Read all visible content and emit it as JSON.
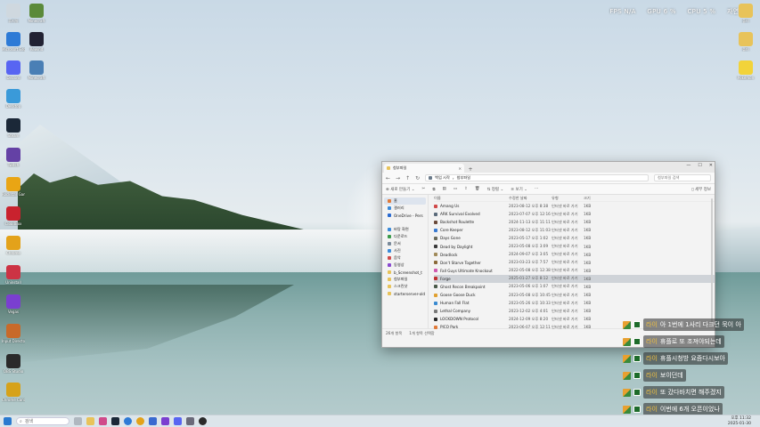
{
  "hud": {
    "fps_label": "FPS",
    "fps_value": "N/A",
    "gpu_label": "GPU",
    "gpu_value": "6 %",
    "cpu_label": "CPU",
    "cpu_value": "5 %",
    "extra": "자연사이"
  },
  "desktop_left": [
    {
      "label": "휴지통",
      "icon": "recycle-bin-icon",
      "color": "#cfd8df"
    },
    {
      "label": "Minecraft",
      "icon": "minecraft-icon",
      "color": "#5b8a3a"
    },
    {
      "label": "Microsoft Edge",
      "icon": "edge-icon",
      "color": "#2d7ad6"
    },
    {
      "label": "Rewind",
      "icon": "r-app-icon",
      "color": "#223"
    },
    {
      "label": "Discord",
      "icon": "discord-icon",
      "color": "#5865f2"
    },
    {
      "label": "Minecraft",
      "icon": "app-icon",
      "color": "#4a7fb5"
    },
    {
      "label": "Desktop",
      "icon": "monitor-icon",
      "color": "#3a9ad9"
    },
    {
      "label": "Steam",
      "icon": "steam-icon",
      "color": "#1b2838"
    },
    {
      "label": "Twitch",
      "icon": "twitch-icon",
      "color": "#6441a5"
    },
    {
      "label": "Rockstar Games",
      "icon": "rockstar-icon",
      "color": "#e9a514"
    },
    {
      "label": "CloudBox",
      "icon": "red-app-icon",
      "color": "#c9222e"
    },
    {
      "label": "Chrome",
      "icon": "chrome-icon",
      "color": "#e3a21a"
    },
    {
      "label": "Uninstall",
      "icon": "shield-icon",
      "color": "#cc3344"
    },
    {
      "label": "Vegas",
      "icon": "x-app-icon",
      "color": "#7a3fd0"
    },
    {
      "label": "Input Director",
      "icon": "id-icon",
      "color": "#c86a2a"
    },
    {
      "label": "OBS Studio",
      "icon": "obs-icon",
      "color": "#2a2a2a"
    },
    {
      "label": "Chrome Canary",
      "icon": "canary-icon",
      "color": "#d6a21a"
    }
  ],
  "desktop_right": [
    {
      "label": "폴더",
      "icon": "folder-icon",
      "color": "#e8c35a"
    },
    {
      "label": "폴더",
      "icon": "folder-icon",
      "color": "#e8c35a"
    },
    {
      "label": "Pokémon",
      "icon": "pikachu-icon",
      "color": "#f2d33a"
    }
  ],
  "explorer": {
    "tab_title": "첨부파일",
    "path_root": "백업 시작",
    "path_current": "첨부파일",
    "search_placeholder": "첨부파일 검색",
    "toolbar": {
      "new": "새로 만들기",
      "sort": "정렬",
      "view": "보기",
      "more": "···",
      "details": "세부 정보"
    },
    "sidebar": [
      {
        "label": "홈",
        "icon": "home-icon",
        "color": "#e07a3a",
        "selected": true
      },
      {
        "label": "갤러리",
        "icon": "gallery-icon",
        "color": "#3a8ad9"
      },
      {
        "label": "OneDrive - Pers",
        "icon": "onedrive-icon",
        "color": "#2a6ad0"
      },
      {
        "label": "바탕 화면",
        "icon": "desktop-icon",
        "color": "#3a8ad9"
      },
      {
        "label": "다운로드",
        "icon": "download-icon",
        "color": "#3a9a4a"
      },
      {
        "label": "문서",
        "icon": "document-icon",
        "color": "#7a8a9a"
      },
      {
        "label": "사진",
        "icon": "pictures-icon",
        "color": "#3a8ad9"
      },
      {
        "label": "음악",
        "icon": "music-icon",
        "color": "#d04a4a"
      },
      {
        "label": "동영상",
        "icon": "video-icon",
        "color": "#8a4ad0"
      },
      {
        "label": "b_Screenshot_t",
        "icon": "folder-icon",
        "color": "#e8c35a"
      },
      {
        "label": "첨부파일",
        "icon": "folder-icon",
        "color": "#e8c35a"
      },
      {
        "label": "스크린샷",
        "icon": "folder-icon",
        "color": "#e8c35a"
      },
      {
        "label": "starterserver-old",
        "icon": "folder-icon",
        "color": "#e8c35a"
      }
    ],
    "columns": [
      "이름",
      "수정한 날짜",
      "유형",
      "크기"
    ],
    "files": [
      {
        "name": "Amang Us",
        "date": "2023-08-12 오후 8:38",
        "type": "인터넷 바로 가기",
        "size": "1KB",
        "color": "#d04a4a"
      },
      {
        "name": "ARK Survival Evolved",
        "date": "2023-07-07 오후 12:16",
        "type": "인터넷 바로 가기",
        "size": "1KB",
        "color": "#5a6a7a"
      },
      {
        "name": "Backshot Roulette",
        "date": "2024-11-13 오후 11:11",
        "type": "인터넷 바로 가기",
        "size": "1KB",
        "color": "#6a4a3a"
      },
      {
        "name": "Core Keeper",
        "date": "2023-08-12 오후 11:03",
        "type": "인터넷 바로 가기",
        "size": "1KB",
        "color": "#3a7ad0"
      },
      {
        "name": "Days Gone",
        "date": "2023-05-17 오후 1:02",
        "type": "인터넷 바로 가기",
        "size": "1KB",
        "color": "#6a6a5a"
      },
      {
        "name": "Dead by Daylight",
        "date": "2023-05-08 오후 3:09",
        "type": "인터넷 바로 가기",
        "size": "1KB",
        "color": "#3a3a3a"
      },
      {
        "name": "Deadlock",
        "date": "2024-09-07 오후 3:05",
        "type": "인터넷 바로 가기",
        "size": "1KB",
        "color": "#a08a5a"
      },
      {
        "name": "Don't Starve Together",
        "date": "2023-03-23 오후 7:57",
        "type": "인터넷 바로 가기",
        "size": "1KB",
        "color": "#8a6a3a"
      },
      {
        "name": "Fall Guys Ultimate Knockout",
        "date": "2022-05-08 오후 12:38",
        "type": "인터넷 바로 가기",
        "size": "1KB",
        "color": "#d05ab0"
      },
      {
        "name": "Forge",
        "date": "2025-01-27 오후 8:12",
        "type": "인터넷 바로 가기",
        "size": "1KB",
        "color": "#c03030",
        "selected": true
      },
      {
        "name": "Ghost Recon Breakpoint",
        "date": "2023-05-06 오후 1:07",
        "type": "인터넷 바로 가기",
        "size": "1KB",
        "color": "#4a5a4a"
      },
      {
        "name": "Goose Goose Duck",
        "date": "2023-05-08 오후 10:45",
        "type": "인터넷 바로 가기",
        "size": "1KB",
        "color": "#e0a030"
      },
      {
        "name": "Human Fall Flat",
        "date": "2023-05-26 오후 10:33",
        "type": "인터넷 바로 가기",
        "size": "1KB",
        "color": "#3a8ad0"
      },
      {
        "name": "Lethal Company",
        "date": "2023-12-02 오후 4:01",
        "type": "인터넷 바로 가기",
        "size": "1KB",
        "color": "#7a7a7a"
      },
      {
        "name": "LOCKDOWN Protocol",
        "date": "2024-12-09 오후 8:20",
        "type": "인터넷 바로 가기",
        "size": "1KB",
        "color": "#2a2a2a"
      },
      {
        "name": "PICO Park",
        "date": "2023-06-07 오후 12:11",
        "type": "인터넷 바로 가기",
        "size": "1KB",
        "color": "#e07a3a"
      }
    ],
    "status": {
      "count": "26개 항목",
      "selected": "1개 항목 선택함"
    }
  },
  "chat": [
    {
      "name": "라이",
      "text": "아 1번에 1사리 다크던 묵이 아"
    },
    {
      "name": "라이",
      "text": "휴플로 또 조져야되는데"
    },
    {
      "name": "라이",
      "text": "휴플시청방 요즘다시보아"
    },
    {
      "name": "라이",
      "text": "보이던데"
    },
    {
      "name": "라이",
      "text": "또 갔다바치면 해주겠지"
    },
    {
      "name": "라이",
      "text": "이번에 6개 오픈이었나"
    }
  ],
  "taskbar": {
    "search_label": "검색",
    "time": "오후 11:32",
    "date": "2025-01-30"
  }
}
